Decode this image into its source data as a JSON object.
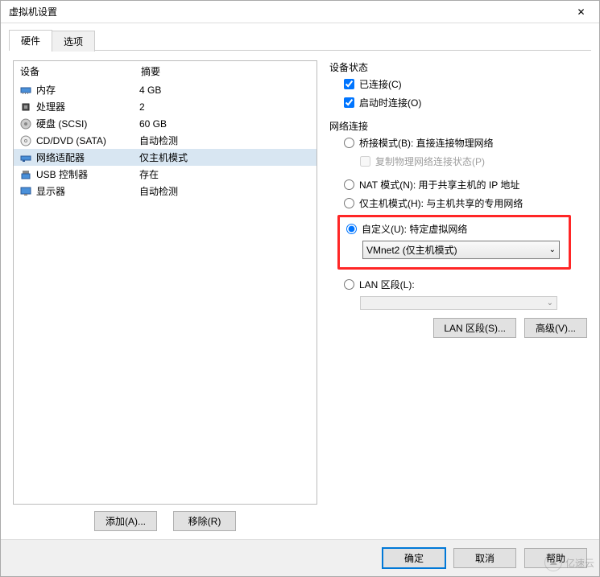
{
  "window": {
    "title": "虚拟机设置"
  },
  "tabs": {
    "hardware": "硬件",
    "options": "选项",
    "active": "hardware"
  },
  "deviceList": {
    "header": {
      "device": "设备",
      "summary": "摘要"
    },
    "rows": [
      {
        "icon": "memory-icon",
        "name": "内存",
        "summary": "4 GB",
        "selected": false
      },
      {
        "icon": "cpu-icon",
        "name": "处理器",
        "summary": "2",
        "selected": false
      },
      {
        "icon": "disk-icon",
        "name": "硬盘 (SCSI)",
        "summary": "60 GB",
        "selected": false
      },
      {
        "icon": "cd-icon",
        "name": "CD/DVD (SATA)",
        "summary": "自动检测",
        "selected": false
      },
      {
        "icon": "network-icon",
        "name": "网络适配器",
        "summary": "仅主机模式",
        "selected": true
      },
      {
        "icon": "usb-icon",
        "name": "USB 控制器",
        "summary": "存在",
        "selected": false
      },
      {
        "icon": "display-icon",
        "name": "显示器",
        "summary": "自动检测",
        "selected": false
      }
    ]
  },
  "leftButtons": {
    "add": "添加(A)...",
    "remove": "移除(R)"
  },
  "status": {
    "groupLabel": "设备状态",
    "connected": {
      "label": "已连接(C)",
      "checked": true
    },
    "connectAtPowerOn": {
      "label": "启动时连接(O)",
      "checked": true
    }
  },
  "network": {
    "groupLabel": "网络连接",
    "bridged": {
      "label": "桥接模式(B): 直接连接物理网络",
      "selected": false
    },
    "replicate": {
      "label": "复制物理网络连接状态(P)",
      "checked": false,
      "disabled": true
    },
    "nat": {
      "label": "NAT 模式(N): 用于共享主机的 IP 地址",
      "selected": false
    },
    "hostOnly": {
      "label": "仅主机模式(H): 与主机共享的专用网络",
      "selected": false
    },
    "custom": {
      "label": "自定义(U): 特定虚拟网络",
      "selected": true,
      "value": "VMnet2 (仅主机模式)"
    },
    "lanSegment": {
      "label": "LAN 区段(L):",
      "selected": false,
      "value": ""
    }
  },
  "rightButtons": {
    "lanSegments": "LAN 区段(S)...",
    "advanced": "高级(V)..."
  },
  "footer": {
    "ok": "确定",
    "cancel": "取消",
    "help": "帮助"
  },
  "watermark": {
    "text": "亿速云"
  }
}
